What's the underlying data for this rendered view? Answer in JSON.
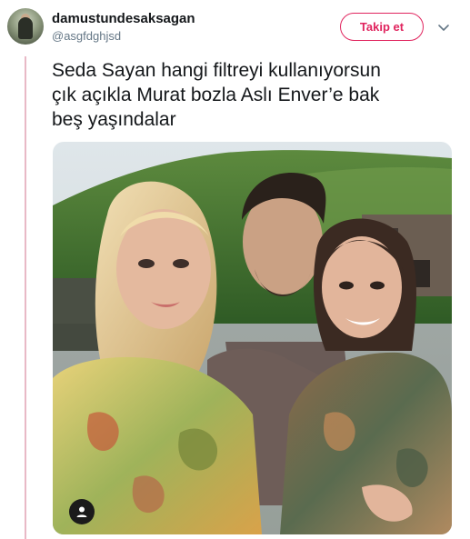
{
  "tweet": {
    "display_name": "damustundesaksagan",
    "handle": "@asgfdghjsd",
    "follow_label": "Takip et",
    "text_lines": [
      "Seda Sayan hangi filtreyi kullanıyorsun",
      "çık açıkla Murat bozla Aslı Enver’e bak",
      "beş yaşındalar"
    ]
  },
  "colors": {
    "accent": "#e0245e",
    "thread_line": "#e8b9c6",
    "handle_gray": "#657786"
  },
  "icons": {
    "avatar": "profile-photo",
    "menu": "chevron-down-icon",
    "media_badge": "person-icon"
  }
}
